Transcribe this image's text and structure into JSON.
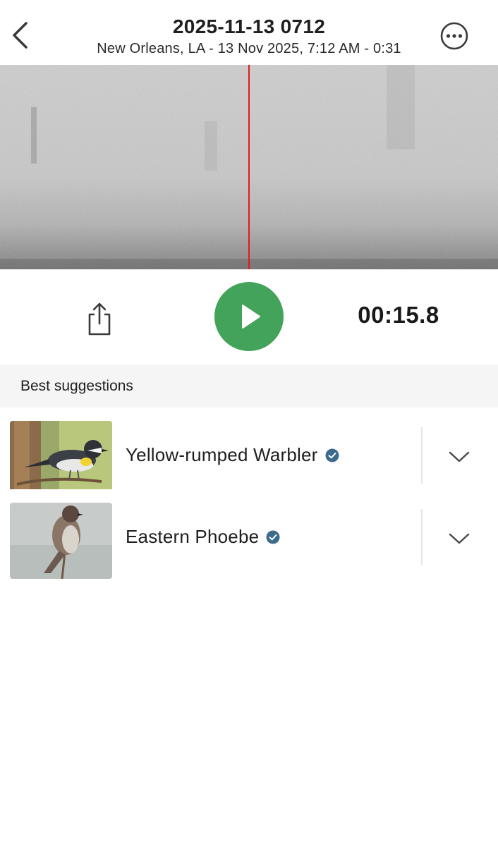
{
  "header": {
    "title": "2025-11-13 0712",
    "subtitle": "New Orleans, LA - 13 Nov 2025, 7:12 AM - 0:31",
    "back_icon": "chevron-left-icon",
    "more_icon": "more-circle-icon"
  },
  "spectrogram": {
    "playhead_color": "#e01b1b"
  },
  "player": {
    "elapsed": "00:15.8",
    "share_icon": "share-icon",
    "play_icon": "play-icon",
    "play_color": "#43a35a"
  },
  "suggestions": {
    "section_title": "Best suggestions",
    "items": [
      {
        "name": "Yellow-rumped Warbler",
        "verified": true,
        "thumbnail": "yellow-rumped-warbler-photo"
      },
      {
        "name": "Eastern Phoebe",
        "verified": true,
        "thumbnail": "eastern-phoebe-photo"
      }
    ],
    "verified_color": "#3d6b8c"
  }
}
